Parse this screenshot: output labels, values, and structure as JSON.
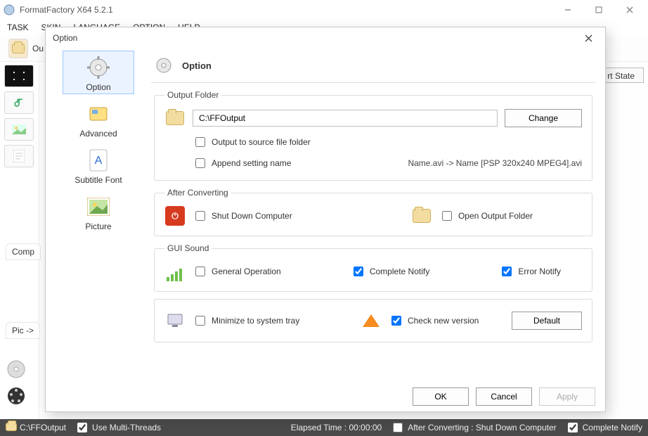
{
  "window": {
    "title": "FormatFactory X64 5.2.1",
    "menus": [
      "TASK",
      "SKIN",
      "LANGUAGE",
      "OPTION",
      "HELP"
    ],
    "toolbar_output_label": "Ou",
    "convert_state": "rt State",
    "side_labels": {
      "compute": "Comp",
      "pic": "Pic ->"
    }
  },
  "statusbar": {
    "output_path": "C:\\FFOutput",
    "use_multithreads": "Use Multi-Threads",
    "elapsed": "Elapsed Time :  00:00:00",
    "after_conv": "After Converting : Shut Down Computer",
    "complete_notify": "Complete Notify"
  },
  "dialog": {
    "title": "Option",
    "nav": [
      {
        "key": "option",
        "label": "Option",
        "selected": true
      },
      {
        "key": "advanced",
        "label": "Advanced",
        "selected": false
      },
      {
        "key": "subtitle",
        "label": "Subtitle Font",
        "selected": false
      },
      {
        "key": "picture",
        "label": "Picture",
        "selected": false
      }
    ],
    "heading": "Option",
    "output_folder": {
      "legend": "Output Folder",
      "path": "C:\\FFOutput",
      "change": "Change",
      "to_source": "Output to source file folder",
      "append_setting": "Append setting name",
      "example": "Name.avi  ->  Name [PSP 320x240 MPEG4].avi"
    },
    "after_converting": {
      "legend": "After Converting",
      "shutdown": "Shut Down Computer",
      "open_folder": "Open Output Folder"
    },
    "gui_sound": {
      "legend": "GUI Sound",
      "general": "General Operation",
      "complete": "Complete Notify",
      "error": "Error Notify"
    },
    "misc": {
      "minimize": "Minimize to system tray",
      "check_new": "Check new version",
      "default_btn": "Default"
    },
    "buttons": {
      "ok": "OK",
      "cancel": "Cancel",
      "apply": "Apply"
    }
  }
}
